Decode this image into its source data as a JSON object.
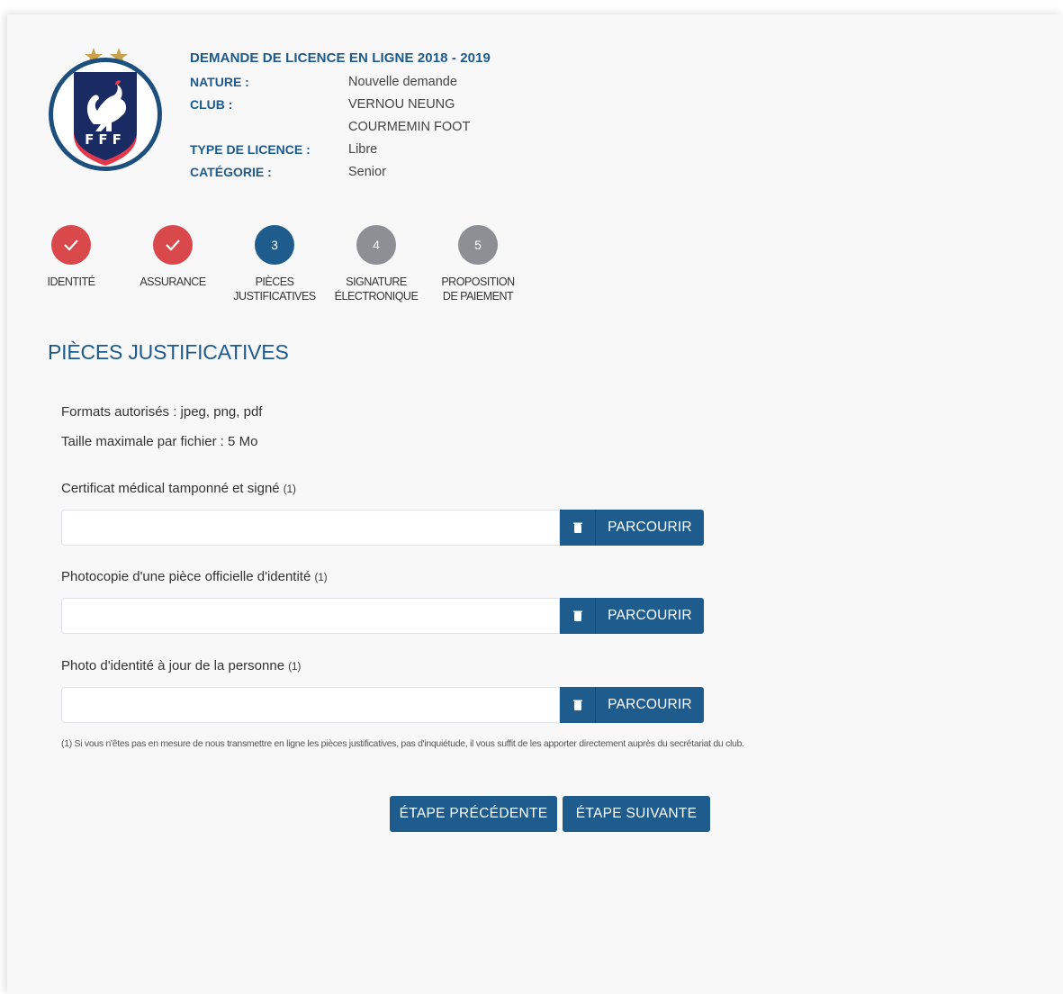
{
  "header": {
    "title": "DEMANDE DE LICENCE EN LIGNE 2018 - 2019",
    "logo_text": "FFF",
    "rows": [
      {
        "label": "NATURE :",
        "value": "Nouvelle demande"
      },
      {
        "label": "CLUB :",
        "value": "VERNOU NEUNG"
      },
      {
        "label": "",
        "value": "COURMEMIN FOOT"
      },
      {
        "label": "TYPE DE LICENCE :",
        "value": "Libre"
      },
      {
        "label": "CATÉGORIE :",
        "value": "Senior"
      }
    ]
  },
  "steps": [
    {
      "number": "1",
      "label_line1": "IDENTITÉ",
      "label_line2": "",
      "status": "done"
    },
    {
      "number": "2",
      "label_line1": "ASSURANCE",
      "label_line2": "",
      "status": "done"
    },
    {
      "number": "3",
      "label_line1": "PIÈCES",
      "label_line2": "JUSTIFICATIVES",
      "status": "active"
    },
    {
      "number": "4",
      "label_line1": "SIGNATURE",
      "label_line2": "ÉLECTRONIQUE",
      "status": "todo"
    },
    {
      "number": "5",
      "label_line1": "PROPOSITION",
      "label_line2": "DE PAIEMENT",
      "status": "todo"
    }
  ],
  "section_title": "PIÈCES JUSTIFICATIVES",
  "formats_text": "Formats autorisés : jpeg, png, pdf",
  "max_size_text": "Taille maximale par fichier : 5 Mo",
  "fields": [
    {
      "label": "Certificat médical tamponné et signé",
      "note": "(1)",
      "value": "",
      "browse_label": "PARCOURIR"
    },
    {
      "label": "Photocopie d'une pièce officielle d'identité",
      "note": "(1)",
      "value": "",
      "browse_label": "PARCOURIR"
    },
    {
      "label": "Photo d'identité à jour de la personne",
      "note": "(1)",
      "value": "",
      "browse_label": "PARCOURIR"
    }
  ],
  "footnote": "(1) Si vous n'êtes pas en mesure de nous transmettre en ligne les pièces justificatives, pas d'inquiétude, il vous suffit de les apporter directement auprès du secrétariat du club.",
  "buttons": {
    "previous": "ÉTAPE PRÉCÉDENTE",
    "next": "ÉTAPE SUIVANTE"
  },
  "colors": {
    "primary": "#1f5c8e",
    "done": "#d9484b",
    "todo": "#8c8f93"
  },
  "icons": {
    "step_done": "check-icon",
    "field_clear": "trash-icon"
  }
}
